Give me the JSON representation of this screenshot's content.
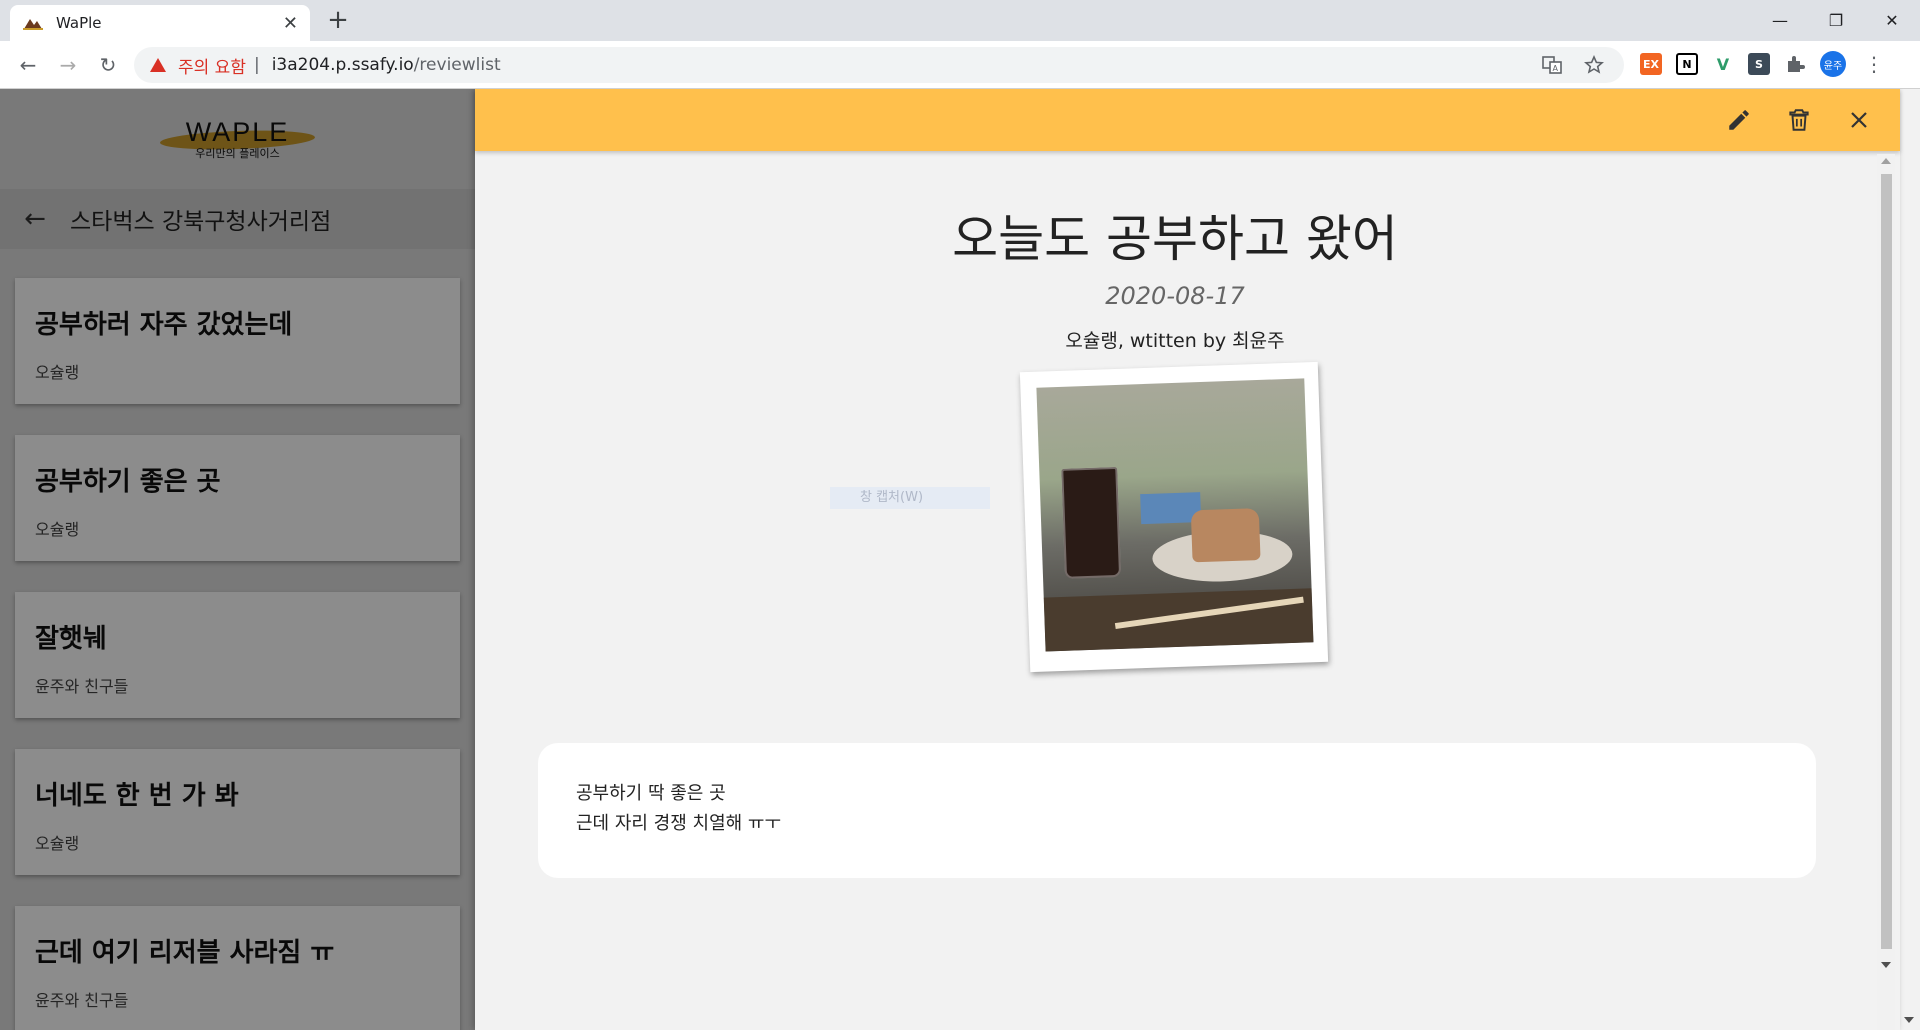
{
  "browser": {
    "tab_title": "WaPle",
    "tab_close": "✕",
    "new_tab": "+",
    "window_controls": {
      "minimize": "—",
      "restore": "❐",
      "close": "✕"
    },
    "nav": {
      "back": "←",
      "forward": "→",
      "reload": "↻"
    },
    "security_warning": "주의 요함",
    "separator": "|",
    "url_host": "i3a204.p.ssafy.io",
    "url_path": "/reviewlist",
    "extensions": [
      "EX",
      "N",
      "V",
      "S"
    ],
    "avatar_label": "윤주",
    "menu": "⋮"
  },
  "sidebar": {
    "logo_text": "WAPLE",
    "logo_subtitle": "우리만의 플레이스",
    "back_icon": "←",
    "store_name": "스타벅스 강북구청사거리점",
    "reviews": [
      {
        "title": "공부하러 자주 갔었는데",
        "author": "오슐랭"
      },
      {
        "title": "공부하기 좋은 곳",
        "author": "오슐랭"
      },
      {
        "title": "잘햇눼",
        "author": "윤주와 친구들"
      },
      {
        "title": "너네도 한 번 가 봐",
        "author": "오슐랭"
      },
      {
        "title": "근데 여기 리저블 사라짐 ㅠ",
        "author": "윤주와 친구들"
      }
    ]
  },
  "detail": {
    "title": "오늘도 공부하고 왔어",
    "date": "2020-08-17",
    "byline": "오슐랭, wtitten by 최윤주",
    "capture_hint": "창 캡처(W)",
    "content_lines": [
      "공부하기 딱 좋은 곳",
      "근데 자리 경쟁 치열해 ㅠㅜ"
    ],
    "header_color": "#ffc04c"
  }
}
